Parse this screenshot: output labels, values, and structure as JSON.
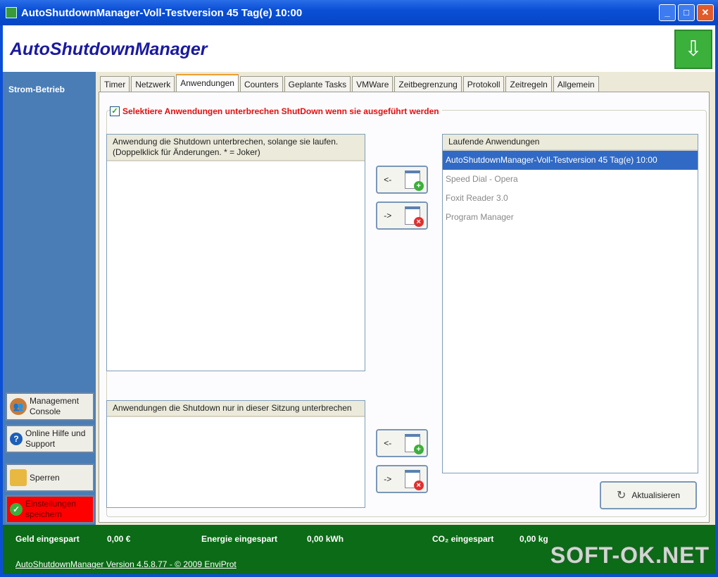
{
  "window": {
    "title": "AutoShutdownManager-Voll-Testversion 45 Tag(e) 10:00",
    "minimize": "_",
    "maximize": "□",
    "close": "✕"
  },
  "header": {
    "brand": "AutoShutdownManager"
  },
  "sidebar": {
    "title": "Strom-Betrieb",
    "buttons": [
      {
        "label": "Management Console",
        "icon": "users-icon"
      },
      {
        "label": "Online Hilfe und Support",
        "icon": "help-icon"
      },
      {
        "label": "Sperren",
        "icon": "lock-icon"
      },
      {
        "label": "Einstellungen speichern",
        "icon": "check-icon"
      }
    ]
  },
  "tabs": [
    "Timer",
    "Netzwerk",
    "Anwendungen",
    "Counters",
    "Geplante Tasks",
    "VMWare",
    "Zeitbegrenzung",
    "Protokoll",
    "Zeitregeln",
    "Allgemein"
  ],
  "active_tab": "Anwendungen",
  "content": {
    "checkbox_label": "Selektiere Anwendungen unterbrechen ShutDown wenn sie ausgeführt werden",
    "checkbox_checked": true,
    "list1_header": "Anwendung die Shutdown unterbrechen, solange sie laufen. (Doppelklick für Änderungen. * = Joker)",
    "list2_header": "Anwendungen die Shutdown nur in dieser Sitzung unterbrechen",
    "running_header": "Laufende Anwendungen",
    "running": [
      "AutoShutdownManager-Voll-Testversion 45 Tag(e) 10:00",
      "Speed Dial - Opera",
      "Foxit Reader 3.0",
      "Program Manager"
    ],
    "add_label": "<-",
    "remove_label": "->",
    "refresh_label": "Aktualisieren"
  },
  "footer": {
    "money_label": "Geld eingespart",
    "money": "0,00 €",
    "energy_label": "Energie eingespart",
    "energy": "0,00 kWh",
    "co2_label": "CO₂ eingespart",
    "co2": "0,00 kg",
    "version": "AutoShutdownManager Version 4.5.8.77  - © 2009 EnviProt"
  },
  "watermark": "SOFT-OK.NET",
  "colors": {
    "accent": "#316ac5",
    "footer": "#0b6b16",
    "save": "#ff0000",
    "sidebar": "#4a7db5"
  }
}
